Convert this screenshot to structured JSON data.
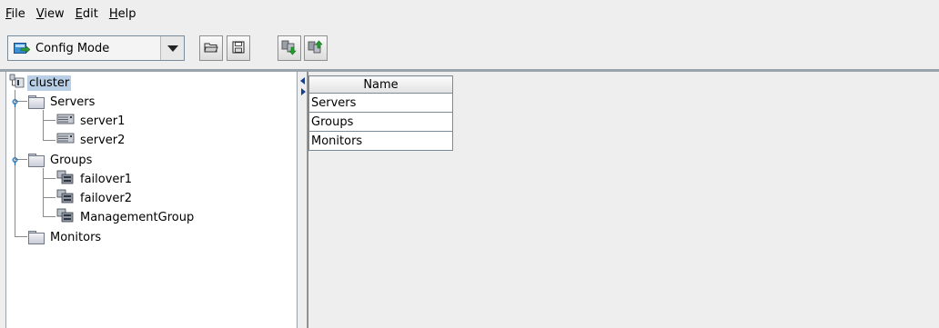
{
  "menu": {
    "items": [
      {
        "mnemonic": "F",
        "rest": "ile"
      },
      {
        "mnemonic": "V",
        "rest": "iew"
      },
      {
        "mnemonic": "E",
        "rest": "dit"
      },
      {
        "mnemonic": "H",
        "rest": "elp"
      }
    ]
  },
  "toolbar": {
    "mode_select": "Config Mode"
  },
  "tree": {
    "root": "cluster",
    "servers_label": "Servers",
    "servers": [
      "server1",
      "server2"
    ],
    "groups_label": "Groups",
    "groups": [
      "failover1",
      "failover2",
      "ManagementGroup"
    ],
    "monitors_label": "Monitors"
  },
  "table": {
    "header": "Name",
    "rows": [
      "Servers",
      "Groups",
      "Monitors"
    ]
  },
  "colors": {
    "selection": "#b8cfe5",
    "accent": "#1b3f8b"
  }
}
